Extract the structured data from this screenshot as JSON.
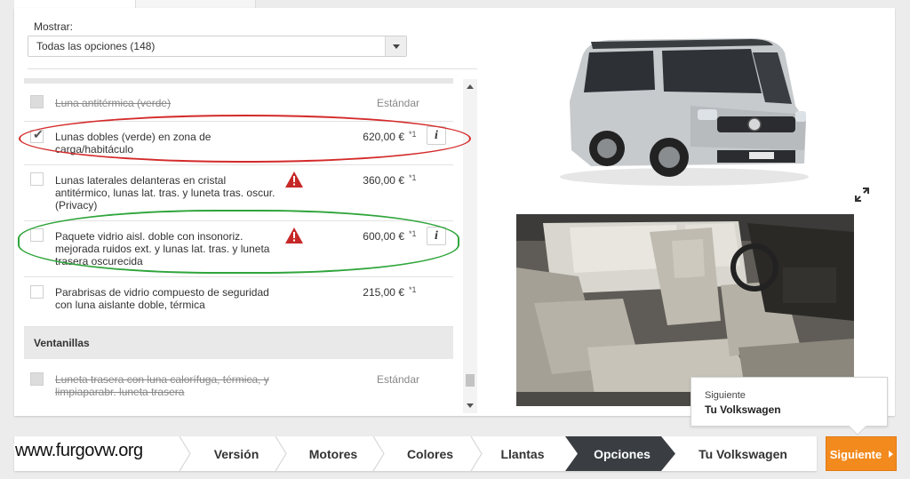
{
  "filter": {
    "label": "Mostrar:",
    "selected": "Todas las opciones (148)"
  },
  "options": [
    {
      "text": "Luna antitérmica (verde)",
      "price": "Estándar",
      "note": "",
      "checked": false,
      "disabled": true,
      "warning": false,
      "info": false
    },
    {
      "text": "Lunas dobles (verde) en zona de carga/habitáculo",
      "price": "620,00 €",
      "note": "*1",
      "checked": true,
      "disabled": false,
      "warning": false,
      "info": true
    },
    {
      "text": "Lunas laterales delanteras en cristal antitérmico, lunas lat. tras. y luneta tras. oscur. (Privacy)",
      "price": "360,00 €",
      "note": "*1",
      "checked": false,
      "disabled": false,
      "warning": true,
      "info": false
    },
    {
      "text": "Paquete vidrio aisl. doble con insonoriz. mejorada ruidos ext. y lunas lat. tras. y luneta trasera oscurecida",
      "price": "600,00 €",
      "note": "*1",
      "checked": false,
      "disabled": false,
      "warning": true,
      "info": true
    },
    {
      "text": "Parabrisas de vidrio compuesto de seguridad con luna aislante doble, térmica",
      "price": "215,00 €",
      "note": "*1",
      "checked": false,
      "disabled": false,
      "warning": false,
      "info": false
    }
  ],
  "section": {
    "title": "Ventanillas",
    "options": [
      {
        "text": "Luneta trasera con luna calorífuga, térmica, y limpiaparabr. luneta trasera",
        "price": "Estándar",
        "checked": false,
        "disabled": true
      }
    ]
  },
  "info_label": "i",
  "tooltip": {
    "line1": "Siguiente",
    "line2": "Tu Volkswagen"
  },
  "nav": {
    "steps": [
      "Versión",
      "Motores",
      "Colores",
      "Llantas",
      "Opciones",
      "Tu Volkswagen"
    ],
    "active": "Opciones",
    "next_label": "Siguiente"
  },
  "watermark": "www.furgovw.org",
  "colors": {
    "accent_orange": "#f28a1e",
    "active_step": "#3a3e43",
    "warning_red": "#c62828",
    "annotation_red": "#d42a2a",
    "annotation_green": "#2fa53b"
  }
}
